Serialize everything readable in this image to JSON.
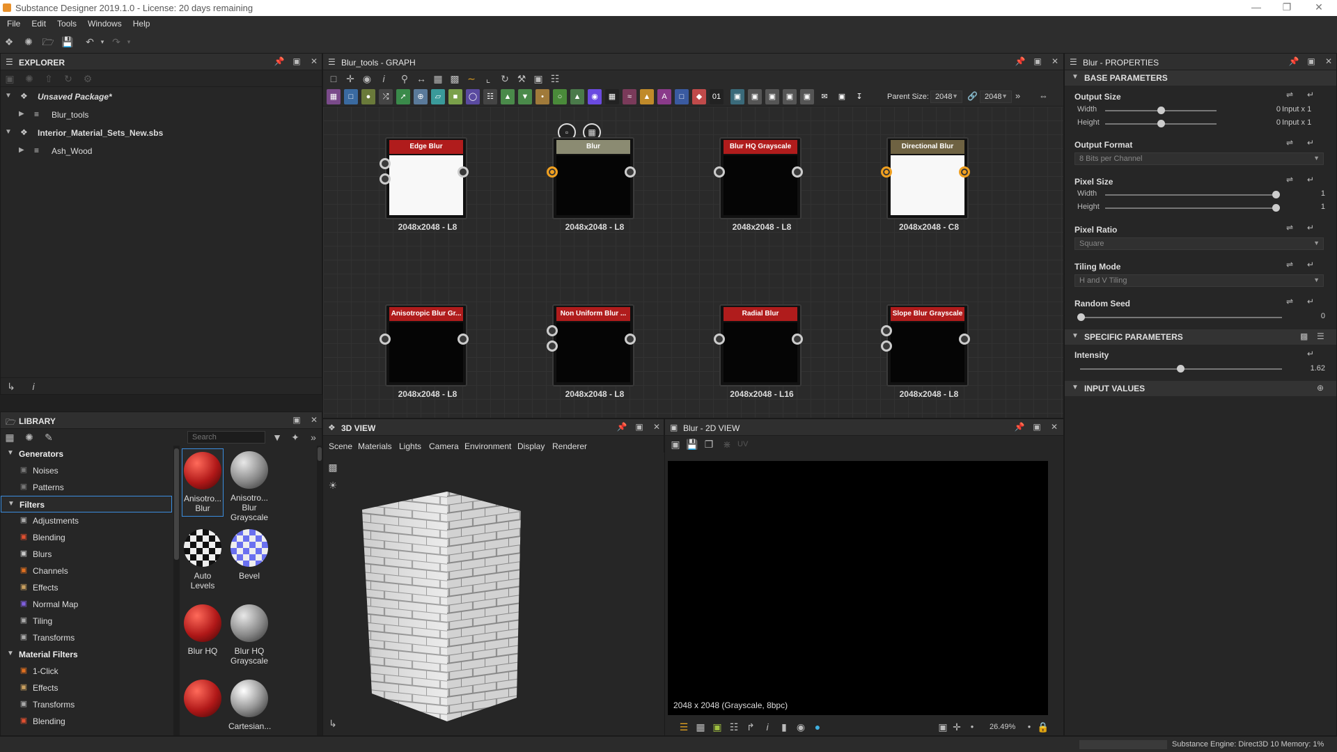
{
  "window": {
    "title": "Substance Designer 2019.1.0 - License: 20 days remaining"
  },
  "menu": [
    "File",
    "Edit",
    "Tools",
    "Windows",
    "Help"
  ],
  "explorer": {
    "title": "EXPLORER",
    "items": [
      {
        "label": "Unsaved Package*"
      },
      {
        "label": "Blur_tools"
      },
      {
        "label": "Interior_Material_Sets_New.sbs"
      },
      {
        "label": "Ash_Wood"
      }
    ]
  },
  "graph": {
    "title": "Blur_tools - GRAPH",
    "parent_size_label": "Parent Size:",
    "parent_size_value": "2048",
    "parent_size_value2": "2048",
    "nodes": [
      {
        "name": "Edge Blur",
        "res": "2048x2048 - L8",
        "header_color": "#b01c1c",
        "preview": "white"
      },
      {
        "name": "Blur",
        "res": "2048x2048 - L8",
        "header_color": "#8b8b72",
        "preview": "black"
      },
      {
        "name": "Blur HQ Grayscale",
        "res": "2048x2048 - L8",
        "header_color": "#b01c1c",
        "preview": "black"
      },
      {
        "name": "Directional Blur",
        "res": "2048x2048 - C8",
        "header_color": "#6e6242",
        "preview": "white"
      },
      {
        "name": "Anisotropic Blur Gr...",
        "res": "2048x2048 - L8",
        "header_color": "#b01c1c",
        "preview": "black"
      },
      {
        "name": "Non Uniform Blur ...",
        "res": "2048x2048 - L8",
        "header_color": "#b01c1c",
        "preview": "black"
      },
      {
        "name": "Radial Blur",
        "res": "2048x2048 - L16",
        "header_color": "#b01c1c",
        "preview": "black"
      },
      {
        "name": "Slope Blur Grayscale",
        "res": "2048x2048 - L8",
        "header_color": "#b01c1c",
        "preview": "black"
      }
    ]
  },
  "properties": {
    "title": "Blur - PROPERTIES",
    "base_section": "BASE PARAMETERS",
    "output_size": {
      "label": "Output Size",
      "width_label": "Width",
      "height_label": "Height",
      "width_value": "0",
      "height_value": "0",
      "width_suffix": "Input x 1",
      "height_suffix": "Input x 1"
    },
    "output_format": {
      "label": "Output Format",
      "value": "8 Bits per Channel"
    },
    "pixel_size": {
      "label": "Pixel Size",
      "width_label": "Width",
      "height_label": "Height",
      "width_value": "1",
      "height_value": "1"
    },
    "pixel_ratio": {
      "label": "Pixel Ratio",
      "value": "Square"
    },
    "tiling_mode": {
      "label": "Tiling Mode",
      "value": "H and V Tiling"
    },
    "random_seed": {
      "label": "Random Seed",
      "value": "0"
    },
    "specific_section": "SPECIFIC PARAMETERS",
    "intensity": {
      "label": "Intensity",
      "value": "1.62",
      "fraction": 0.5
    },
    "input_section": "INPUT VALUES"
  },
  "library": {
    "title": "LIBRARY",
    "search_placeholder": "Search",
    "tree": [
      {
        "type": "header",
        "label": "Generators"
      },
      {
        "type": "item",
        "label": "Noises",
        "color": "#777"
      },
      {
        "type": "item",
        "label": "Patterns",
        "color": "#777"
      },
      {
        "type": "header",
        "label": "Filters",
        "selected": true
      },
      {
        "type": "item",
        "label": "Adjustments",
        "color": "#aaa"
      },
      {
        "type": "item",
        "label": "Blending",
        "color": "#e05030"
      },
      {
        "type": "item",
        "label": "Blurs",
        "color": "#ccc"
      },
      {
        "type": "item",
        "label": "Channels",
        "color": "#e07020"
      },
      {
        "type": "item",
        "label": "Effects",
        "color": "#c9a060"
      },
      {
        "type": "item",
        "label": "Normal Map",
        "color": "#8060e0"
      },
      {
        "type": "item",
        "label": "Tiling",
        "color": "#aaa"
      },
      {
        "type": "item",
        "label": "Transforms",
        "color": "#aaa"
      },
      {
        "type": "header",
        "label": "Material Filters"
      },
      {
        "type": "item",
        "label": "1-Click",
        "color": "#e07020"
      },
      {
        "type": "item",
        "label": "Effects",
        "color": "#c9a060"
      },
      {
        "type": "item",
        "label": "Transforms",
        "color": "#aaa"
      },
      {
        "type": "item",
        "label": "Blending",
        "color": "#e05030"
      }
    ],
    "thumbs": [
      {
        "label": "Anisotro... Blur",
        "style": "red"
      },
      {
        "label": "Anisotro... Blur Grayscale",
        "style": "gray"
      },
      {
        "label": "Auto Levels",
        "style": "checker"
      },
      {
        "label": "Bevel",
        "style": "bevel"
      },
      {
        "label": "Blur HQ",
        "style": "red"
      },
      {
        "label": "Blur HQ Grayscale",
        "style": "gray"
      },
      {
        "label": "",
        "style": "red2"
      },
      {
        "label": "Cartesian...",
        "style": "gray2"
      }
    ]
  },
  "view3d": {
    "title": "3D VIEW",
    "menu": [
      "Scene",
      "Materials",
      "Lights",
      "Camera",
      "Environment",
      "Display",
      "Renderer"
    ]
  },
  "view2d": {
    "title": "Blur - 2D VIEW",
    "uv_label": "UV",
    "info": "2048 x 2048 (Grayscale, 8bpc)",
    "zoom": "26.49%"
  },
  "status": {
    "engine": "Substance Engine: Direct3D 10  Memory: 1%"
  }
}
